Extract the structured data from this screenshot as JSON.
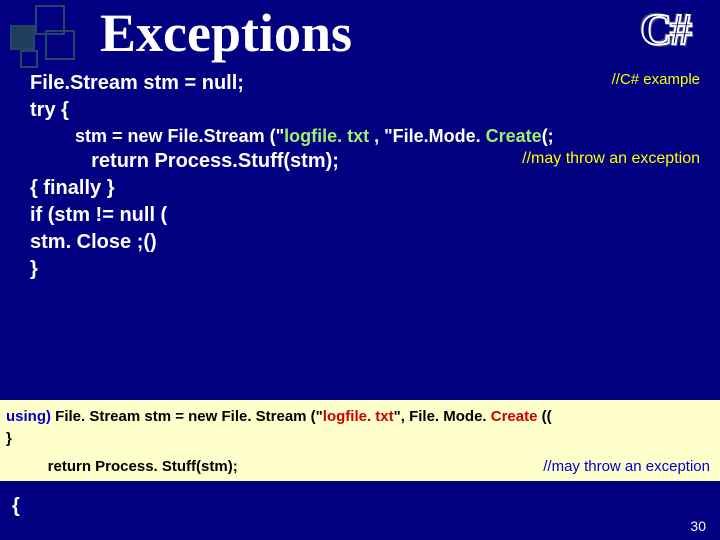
{
  "title": "Exceptions",
  "logo": "C#",
  "main": {
    "l1a": "File.Stream stm = null;",
    "c1": "//C# example",
    "l2": "   try {",
    "l3_pre": "         stm = new File.Stream (\"",
    "l3_str": "logfile. txt",
    "l3_mid": " , \"File.Mode. ",
    "l3_create": "Create",
    "l3_end": "(; ",
    "l4a": "           return Process.Stuff(stm);",
    "c2": "//may throw an exception",
    "l5": "   {   finally }",
    "l6": "           if (stm != null (",
    "l7": "                 stm. Close ;()",
    "l8": "   }"
  },
  "bottom": {
    "l1_pre": "using) ",
    "l1_mid1": "File. Stream stm = new File. Stream (\"",
    "l1_str": "logfile. txt",
    "l1_mid2": "\", File. Mode. ",
    "l1_create": "Create",
    "l1_end": " ((",
    "l2": "          }",
    "l3a": "          return Process. Stuff(stm);",
    "c3": "//may throw an exception"
  },
  "end_brace": "{",
  "page": "30"
}
